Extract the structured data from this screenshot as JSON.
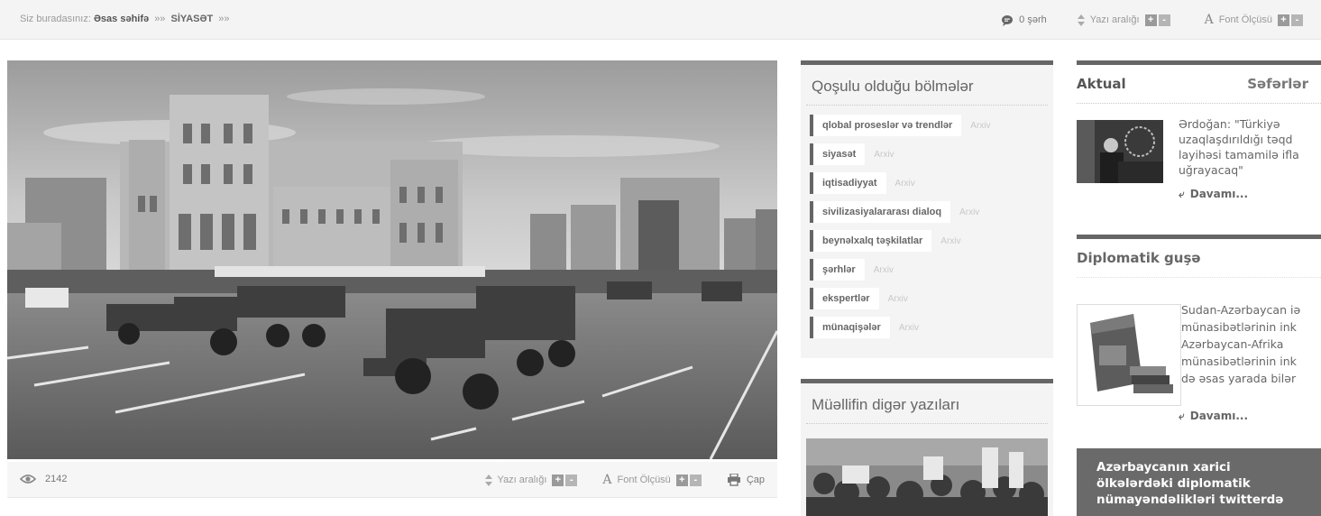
{
  "breadcrumb": {
    "prefix": "Siz buradasınız:",
    "home": "Əsas səhifə",
    "sep1": "»»",
    "section": "SİYASƏT",
    "sep2": "»»"
  },
  "toolbar": {
    "comments": "0 şərh",
    "line_spacing": "Yazı aralığı",
    "font_size": "Font Ölçüsü",
    "plus": "+",
    "minus": "-"
  },
  "photo_bar": {
    "views": "2142",
    "line_spacing": "Yazı aralığı",
    "font_size": "Font Ölçüsü",
    "print": "Çap"
  },
  "sections_box": {
    "title": "Qoşulu olduğu bölmələr",
    "archive_label": "Arxiv",
    "items": [
      {
        "label": "qlobal proseslər və trendlər"
      },
      {
        "label": "siyasət"
      },
      {
        "label": "iqtisadiyyat"
      },
      {
        "label": "sivilizasiyalararası dialoq"
      },
      {
        "label": "beynəlxalq təşkilatlar"
      },
      {
        "label": "şərhlər"
      },
      {
        "label": "ekspertlər"
      },
      {
        "label": "münaqişələr"
      }
    ]
  },
  "author_box": {
    "title": "Müəllifin digər yazıları"
  },
  "right_col": {
    "tab_actual": "Aktual",
    "tab_trips": "Səfərlər",
    "news1": {
      "lines": [
        "Ərdoğan: \"Türkiyə",
        "uzaqlaşdırıldığı təqd",
        "layihəsi tamamilə ifla",
        "uğrayacaq\""
      ],
      "more": "Davamı..."
    },
    "diplomatic_title": "Diplomatik guşə",
    "news2": {
      "lines": [
        "Sudan-Azərbaycan iə",
        "münasibətlərinin ink",
        "Azərbaycan-Afrika",
        "münasibətlərinin ink",
        "də əsas yarada bilər"
      ],
      "more": "Davamı..."
    },
    "twitter_box": {
      "lines": [
        "Azərbaycanın xarici",
        "ölkələrdəki diplomatik",
        "nümayəndəlikləri twitterdə"
      ]
    }
  },
  "icons": {
    "comment": "comment-icon",
    "updown": "updown-arrows-icon",
    "font": "font-a-icon",
    "eye": "eye-icon",
    "print": "printer-icon",
    "back": "back-arrow-icon"
  }
}
